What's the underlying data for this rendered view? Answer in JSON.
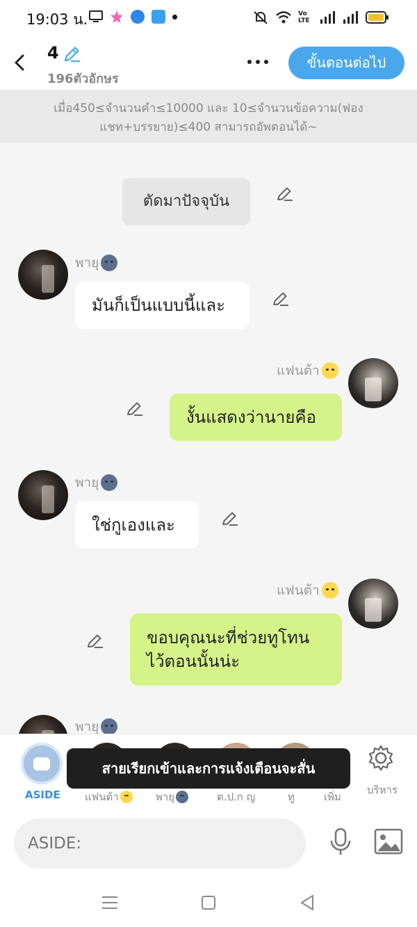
{
  "status": {
    "time": "19:03 น.",
    "network": "Vo LTE"
  },
  "header": {
    "episode_number": "4",
    "char_count": "196ตัวอักษร",
    "next_button": "ขั้นตอนต่อไป"
  },
  "notice": "เมื่อ450≤จำนวนคำ≤10000 และ 10≤จำนวนข้อความ(ฟองแชท+บรรยาย)≤400 สามารถอัพตอนได้~",
  "messages": [
    {
      "type": "narration",
      "text": "ตัดมาปัจจุบัน"
    },
    {
      "sender": "พายุ",
      "emoji": "moon-face",
      "side": "left",
      "text": "มันก็เป็นแบบนี้และ"
    },
    {
      "sender": "แฟนต้า",
      "emoji": "sun-face",
      "side": "right",
      "text": "งั้นแสดงว่านายคือ"
    },
    {
      "sender": "พายุ",
      "emoji": "moon-face",
      "side": "left",
      "text": "ใช่กูเองและ"
    },
    {
      "sender": "แฟนต้า",
      "emoji": "sun-face",
      "side": "right",
      "text": "ขอบคุณนะที่ช่วยทูโทนไว้ตอนนั้นน่ะ"
    },
    {
      "sender": "พายุ",
      "emoji": "moon-face",
      "side": "left",
      "text": ""
    }
  ],
  "characters": [
    {
      "label": "ASIDE",
      "active": true
    },
    {
      "label": "แฟนต้า",
      "emoji": "sun-face"
    },
    {
      "label": "พายุ",
      "emoji": "moon-face"
    },
    {
      "label": "ต.ป.ก ญ"
    },
    {
      "label": "ทู"
    },
    {
      "label": "เพิ่ม"
    },
    {
      "label": "บริหาร",
      "icon": "gear-icon"
    }
  ],
  "toast": "สายเรียกเข้าและการแจ้งเตือนจะสั่น",
  "input": {
    "placeholder": "ASIDE:"
  },
  "colors": {
    "accent": "#4aa7ec",
    "right_bubble": "#d4f48a",
    "left_bubble": "#ffffff"
  }
}
